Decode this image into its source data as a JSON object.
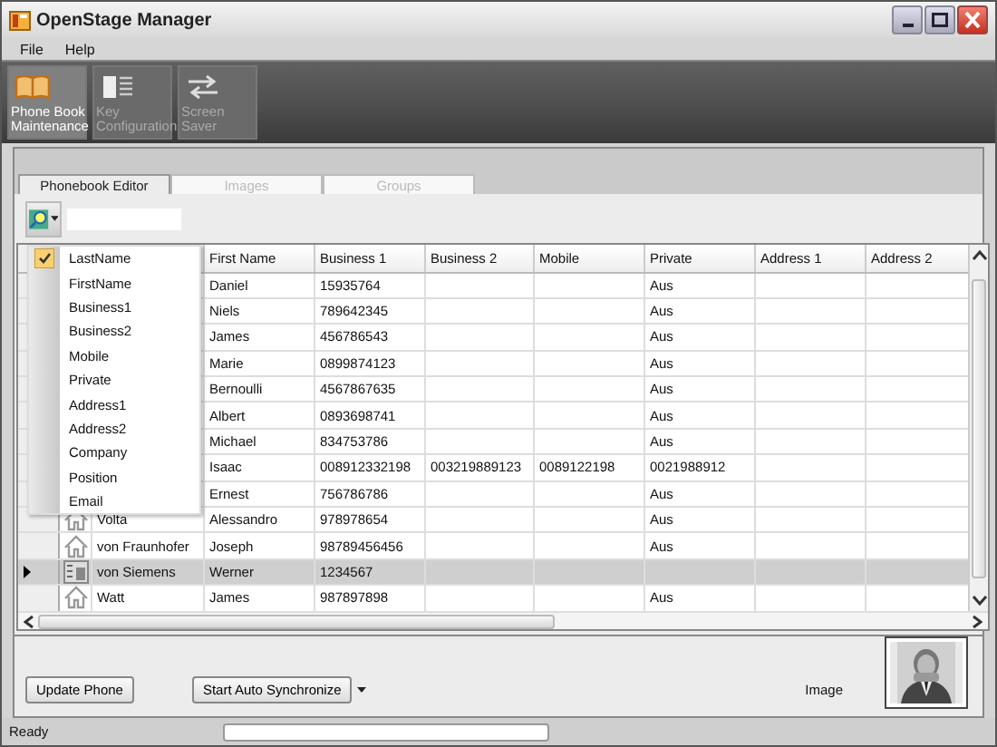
{
  "window": {
    "title": "OpenStage Manager"
  },
  "menu": [
    "File",
    "Help"
  ],
  "toolbar": [
    {
      "kind": "book",
      "label": "Phone Book Maintenance",
      "selected": true
    },
    {
      "kind": "list",
      "label": "Key Configuration",
      "selected": false
    },
    {
      "kind": "swap",
      "label": "Screen Saver",
      "selected": false
    }
  ],
  "tabs": [
    {
      "label": "Phonebook Editor",
      "selected": true
    },
    {
      "label": "Images",
      "selected": false
    },
    {
      "label": "Groups",
      "selected": false
    }
  ],
  "table": {
    "columns": [
      "First Name",
      "Business 1",
      "Business 2",
      "Mobile",
      "Private",
      "Address 1",
      "Address 2"
    ],
    "rows": [
      {
        "first_name": "Daniel",
        "business_1": "15935764",
        "private": "Aus",
        "selected": false,
        "current": false
      },
      {
        "first_name": "Niels",
        "business_1": "789642345",
        "private": "Aus",
        "selected": false,
        "current": false
      },
      {
        "first_name": "James",
        "business_1": "456786543",
        "private": "Aus",
        "selected": false,
        "current": false
      },
      {
        "first_name": "Marie",
        "business_1": "0899874123",
        "private": "Aus",
        "selected": false,
        "current": false
      },
      {
        "first_name": "Bernoulli",
        "business_1": "4567867635",
        "private": "Aus",
        "selected": false,
        "current": false
      },
      {
        "first_name": "Albert",
        "business_1": "0893698741",
        "private": "Aus",
        "selected": false,
        "current": false
      },
      {
        "first_name": "Michael",
        "business_1": "834753786",
        "private": "Aus",
        "selected": false,
        "current": false
      },
      {
        "first_name": "Isaac",
        "business_1": "008912332198",
        "business_2": "003219889123",
        "mobile": "0089122198",
        "private": "0021988912",
        "selected": false,
        "current": false
      },
      {
        "first_name": "Ernest",
        "business_1": "756786786",
        "private": "Aus",
        "selected": false,
        "current": false
      },
      {
        "kind": "house",
        "last_name": "Volta",
        "first_name": "Alessandro",
        "business_1": "978978654",
        "private": "Aus",
        "selected": false,
        "current": false
      },
      {
        "kind": "house",
        "last_name": "von Fraunhofer",
        "first_name": "Joseph",
        "business_1": "98789456456",
        "private": "Aus",
        "selected": false,
        "current": false
      },
      {
        "kind": "card",
        "last_name": "von Siemens",
        "first_name": "Werner",
        "business_1": "1234567",
        "selected": true,
        "current": true
      },
      {
        "kind": "house",
        "last_name": "Watt",
        "first_name": "James",
        "business_1": "987897898",
        "private": "Aus",
        "selected": false,
        "current": false
      }
    ]
  },
  "column_menu": [
    {
      "label": "LastName",
      "checked": true
    },
    {
      "label": "FirstName",
      "checked": false
    },
    {
      "label": "Business1",
      "checked": false
    },
    {
      "label": "Business2",
      "checked": false
    },
    {
      "label": "Mobile",
      "checked": false
    },
    {
      "label": "Private",
      "checked": false
    },
    {
      "label": "Address1",
      "checked": false
    },
    {
      "label": "Address2",
      "checked": false
    },
    {
      "label": "Company",
      "checked": false
    },
    {
      "label": "Position",
      "checked": false
    },
    {
      "label": "Email",
      "checked": false
    }
  ],
  "buttons": {
    "update": "Update Phone",
    "sync": "Start Auto Synchronize"
  },
  "image_label": "Image",
  "image": {
    "kind": "picture"
  },
  "status_bar": {
    "text": "Ready"
  }
}
